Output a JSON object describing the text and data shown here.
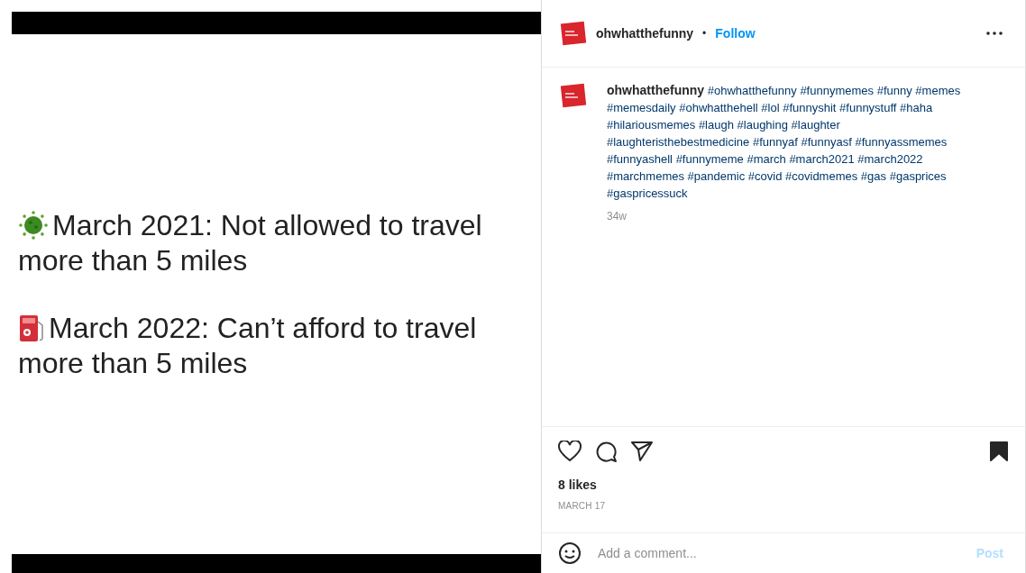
{
  "post_image": {
    "lines": [
      {
        "kind": "virus",
        "text": "March 2021: Not allowed to travel",
        "continuation": "more than 5 miles"
      },
      {
        "kind": "fuel",
        "text": "March 2022: Can’t afford to travel",
        "continuation": "more than 5 miles"
      }
    ]
  },
  "header": {
    "username": "ohwhatthefunny",
    "separator": "•",
    "follow": "Follow"
  },
  "caption": {
    "username": "ohwhatthefunny",
    "hashtags": [
      "#ohwhatthefunny",
      "#funnymemes",
      "#funny",
      "#memes",
      "#memesdaily",
      "#ohwhatthehell",
      "#lol",
      "#funnyshit",
      "#funnystuff",
      "#haha",
      "#hilariousmemes",
      "#laugh",
      "#laughing",
      "#laughter",
      "#laughteristhebestmedicine",
      "#funnyaf",
      "#funnyasf",
      "#funnyassmemes",
      "#funnyashell",
      "#funnymeme",
      "#march",
      "#march2021",
      "#march2022",
      "#marchmemes",
      "#pandemic",
      "#covid",
      "#covidmemes",
      "#gas",
      "#gasprices",
      "#gaspricessuck"
    ],
    "age": "34w"
  },
  "actions": {
    "liked": false,
    "saved": true
  },
  "likes": "8 likes",
  "date": "MARCH 17",
  "comment": {
    "placeholder": "Add a comment...",
    "post": "Post"
  }
}
